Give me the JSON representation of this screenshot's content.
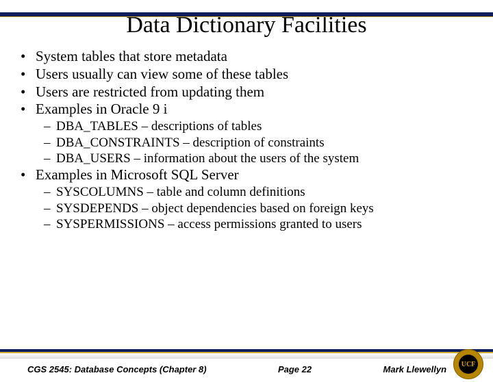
{
  "title": "Data Dictionary Facilities",
  "bullets": {
    "b0": "System tables that store metadata",
    "b1": "Users usually can view some of these tables",
    "b2": "Users are restricted from updating them",
    "b3": "Examples in Oracle 9 i",
    "b3sub": {
      "s0": "DBA_TABLES – descriptions of tables",
      "s1": "DBA_CONSTRAINTS – description of constraints",
      "s2": "DBA_USERS – information about the users of the system"
    },
    "b4": "Examples in Microsoft SQL Server",
    "b4sub": {
      "s0": "SYSCOLUMNS – table and column definitions",
      "s1": "SYSDEPENDS – object dependencies based on foreign keys",
      "s2": "SYSPERMISSIONS – access permissions granted to users"
    }
  },
  "footer": {
    "course": "CGS 2545: Database Concepts  (Chapter 8)",
    "page": "Page 22",
    "author": "Mark Llewellyn"
  },
  "logo": {
    "text": "UCF"
  }
}
